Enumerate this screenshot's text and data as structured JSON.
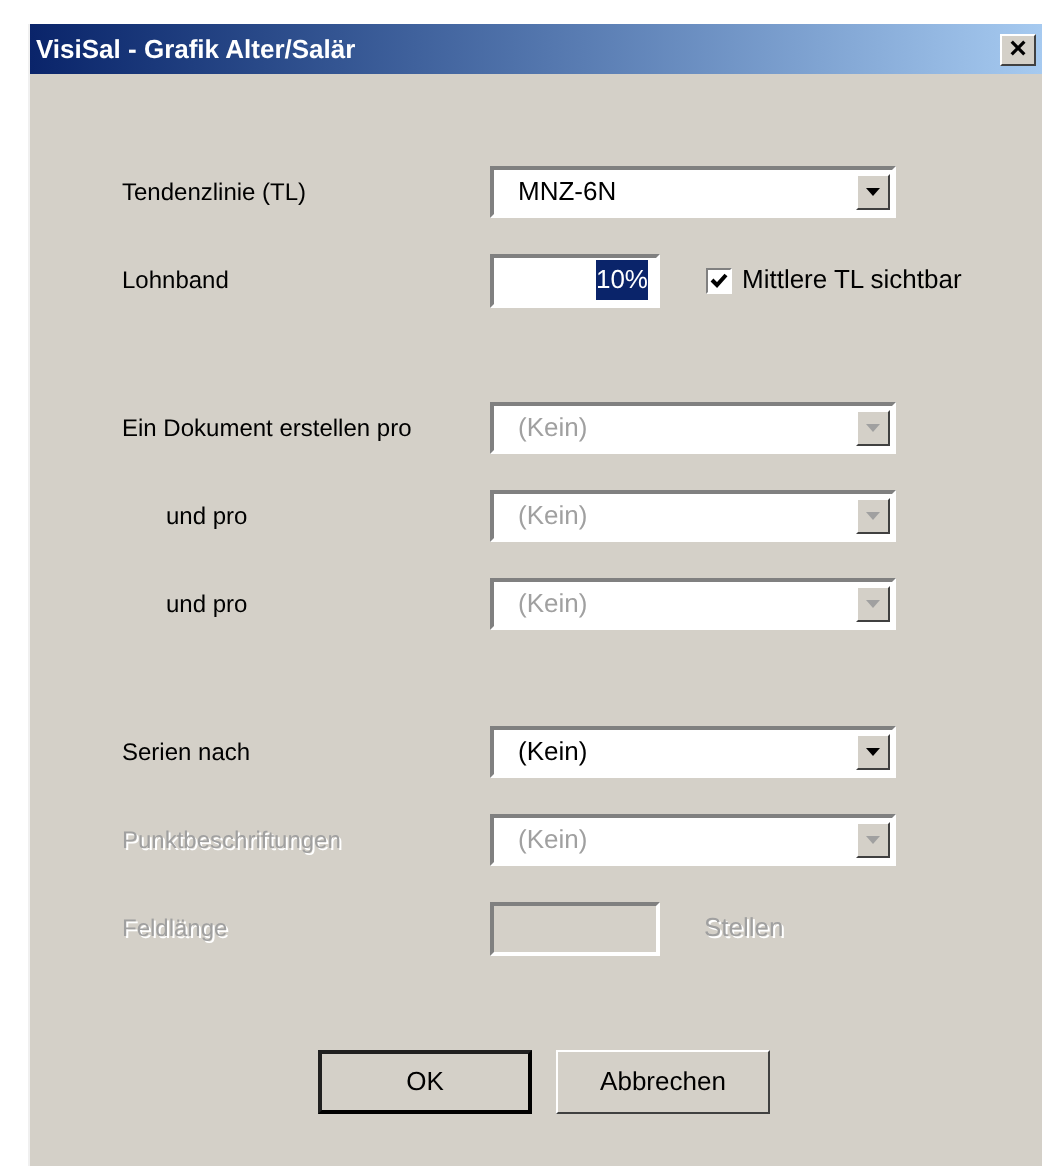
{
  "window": {
    "title": "VisiSal - Grafik Alter/Salär",
    "close": "×"
  },
  "groups": [
    {
      "rows": [
        {
          "kind": "dropdown",
          "label": "Tendenzlinie (TL)",
          "value": "MNZ-6N",
          "disabled": false,
          "indented": false
        },
        {
          "kind": "text",
          "label": "Lohnband",
          "value": "10%",
          "disabled": false,
          "indented": false,
          "value_selected": true,
          "checkbox": {
            "label": "Mittlere TL sichtbar",
            "checked": true
          }
        }
      ]
    },
    {
      "rows": [
        {
          "kind": "dropdown",
          "label": "Ein Dokument erstellen pro",
          "label_disabled": false,
          "value": "(Kein)",
          "disabled": true,
          "indented": false
        },
        {
          "kind": "dropdown",
          "label": "und pro",
          "label_disabled": false,
          "value": "(Kein)",
          "disabled": true,
          "indented": true
        },
        {
          "kind": "dropdown",
          "label": "und pro",
          "label_disabled": false,
          "value": "(Kein)",
          "disabled": true,
          "indented": true
        }
      ]
    },
    {
      "rows": [
        {
          "kind": "dropdown",
          "label": "Serien nach",
          "value": "(Kein)",
          "disabled": false,
          "indented": false
        },
        {
          "kind": "dropdown",
          "label": "Punktbeschriftungen",
          "value": "(Kein)",
          "disabled": true,
          "indented": false
        },
        {
          "kind": "text",
          "label": "Feldlänge",
          "disabled": true,
          "indented": false,
          "suffix": "Stellen"
        }
      ]
    }
  ],
  "buttons": [
    {
      "label": "OK",
      "default": true
    },
    {
      "label": "Abbrechen",
      "default": false
    }
  ]
}
